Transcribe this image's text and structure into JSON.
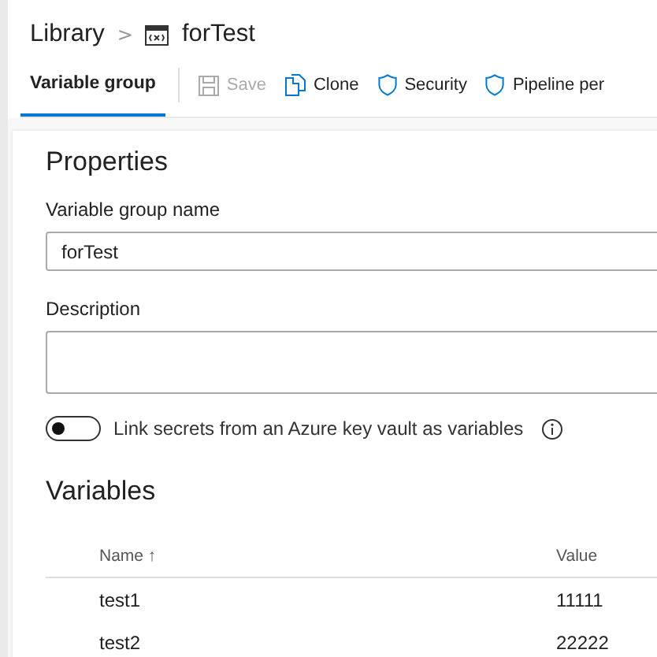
{
  "breadcrumb": {
    "root": "Library",
    "separator": ">",
    "current": "forTest"
  },
  "toolbar": {
    "tab": {
      "label": "Variable group",
      "selected": true
    },
    "actions": [
      {
        "label": "Save",
        "kind": "save",
        "disabled": true
      },
      {
        "label": "Clone",
        "kind": "clone",
        "disabled": false
      },
      {
        "label": "Security",
        "kind": "shield",
        "disabled": false
      },
      {
        "label": "Pipeline per",
        "kind": "shield",
        "disabled": false
      }
    ]
  },
  "properties": {
    "title": "Properties",
    "name_label": "Variable group name",
    "name_value": "forTest",
    "description_label": "Description",
    "link_toggle": {
      "label": "Link secrets from an Azure key vault as variables",
      "on": false
    }
  },
  "variables": {
    "title": "Variables",
    "columns": [
      {
        "label": "Name",
        "sort": "↑"
      },
      {
        "label": "Value"
      }
    ],
    "rows": [
      {
        "name": "test1",
        "value": "11111"
      },
      {
        "name": "test2",
        "value": "22222"
      }
    ]
  }
}
